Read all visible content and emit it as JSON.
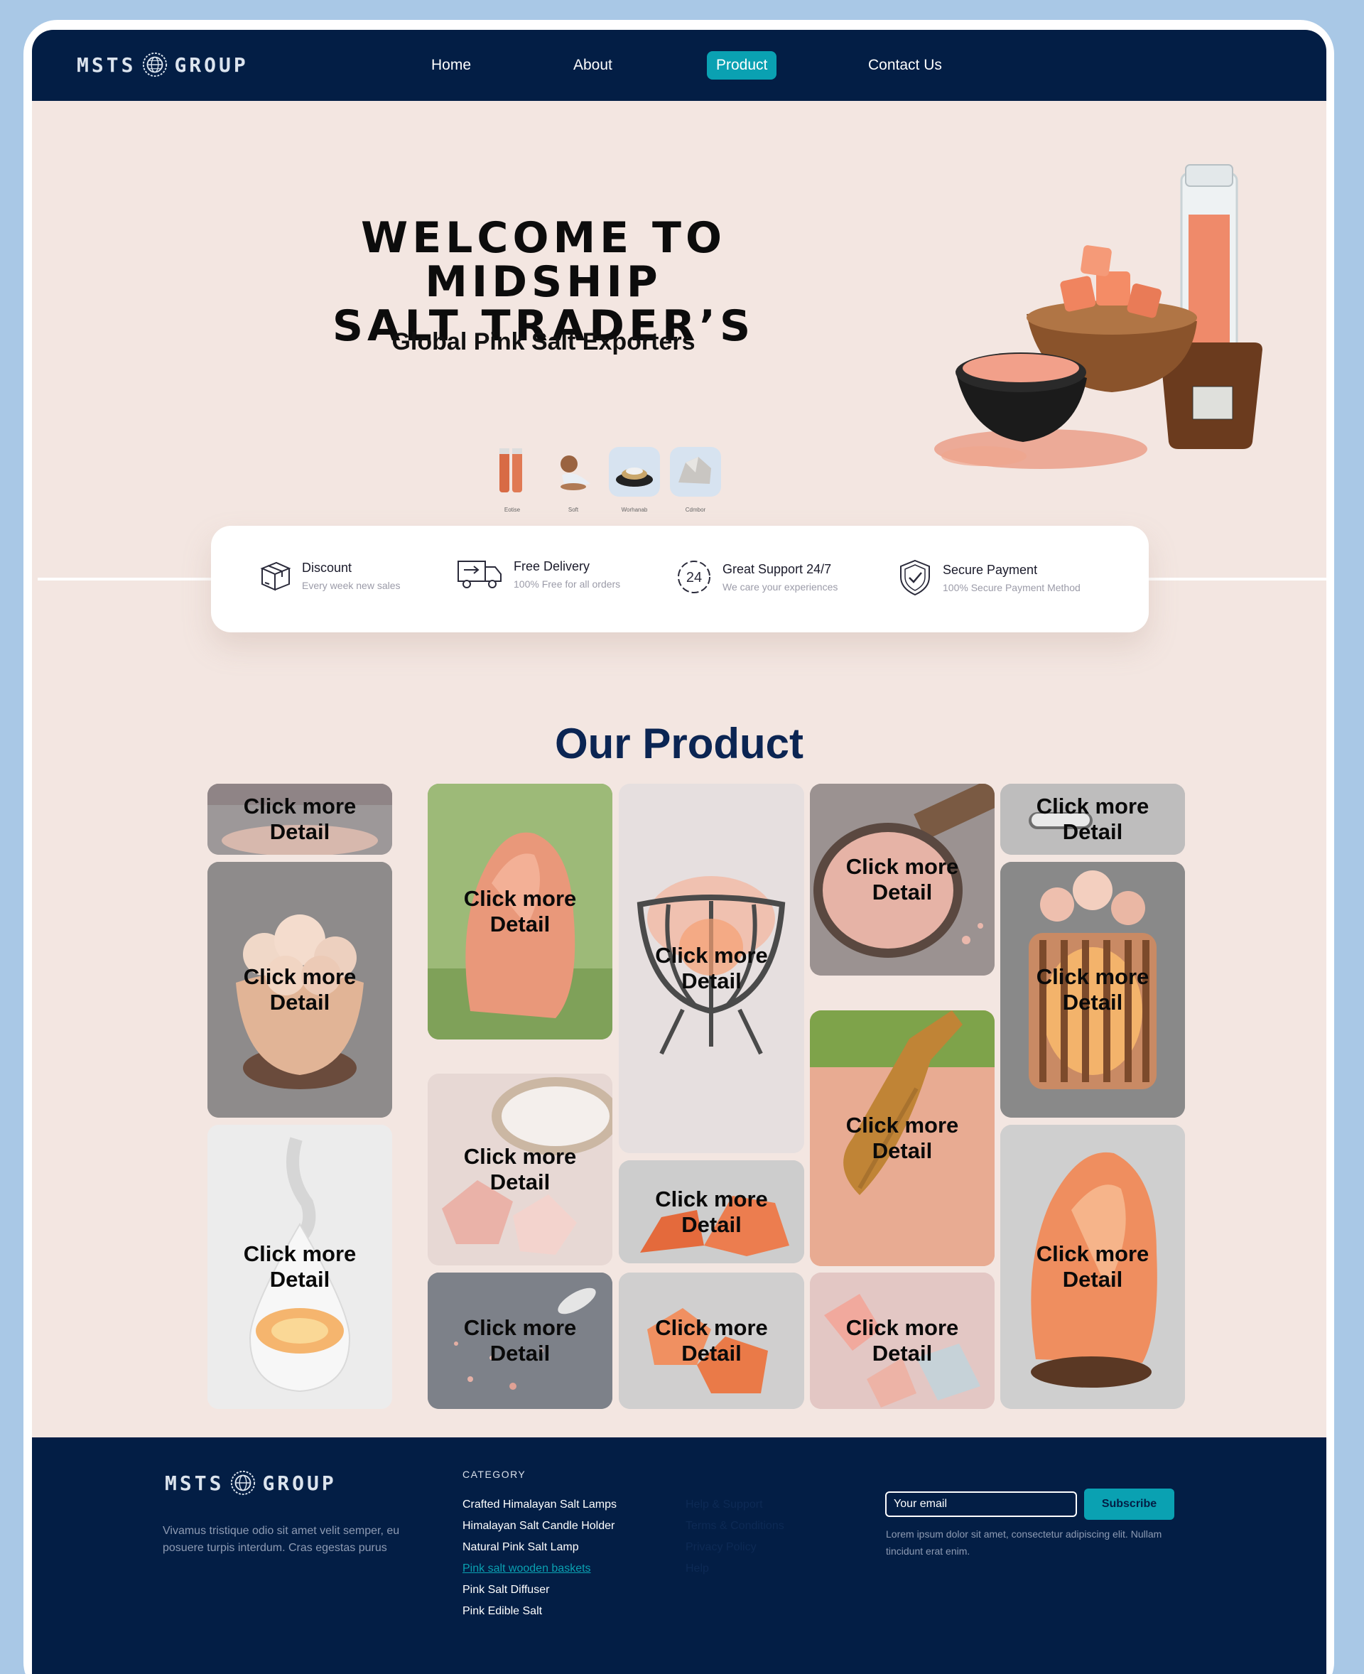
{
  "brand": {
    "name_left": "MSTS",
    "name_right": "GROUP"
  },
  "nav": {
    "items": [
      {
        "label": "Home",
        "active": false
      },
      {
        "label": "About",
        "active": false
      },
      {
        "label": "Product",
        "active": true
      },
      {
        "label": "Contact Us",
        "active": false
      }
    ]
  },
  "hero": {
    "title_line1": "WELCOME TO MIDSHIP",
    "title_line2": "SALT TRADER’S",
    "subtitle": "Global Pink Salt Exporters",
    "thumbs": [
      {
        "caption": "Eotise",
        "icon": "salt-shakers-icon"
      },
      {
        "caption": "Soft",
        "icon": "salt-grinder-icon"
      },
      {
        "caption": "Worhanab",
        "icon": "salt-dish-icon"
      },
      {
        "caption": "Cdmbor",
        "icon": "salt-rock-icon"
      }
    ]
  },
  "features": [
    {
      "title": "Discount",
      "subtitle": "Every week new sales",
      "icon": "box-icon"
    },
    {
      "title": "Free Delivery",
      "subtitle": "100% Free for all orders",
      "icon": "truck-icon"
    },
    {
      "title": "Great Support 24/7",
      "subtitle": "We care your experiences",
      "icon": "support-24-icon"
    },
    {
      "title": "Secure Payment",
      "subtitle": "100% Secure Payment Method",
      "icon": "shield-check-icon"
    }
  ],
  "products": {
    "title": "Our Product",
    "tile_line1": "Click more",
    "tile_line2": "Detail",
    "tiles": [
      "salt-bowl-tile",
      "crystal-bowl-lamp-tile",
      "salt-diffuser-tile",
      "natural-salt-lamp-tile",
      "white-salt-chunks-tile",
      "salt-on-slate-tile",
      "basket-lamp-tile",
      "orange-rock-tile",
      "orange-chunks-tile",
      "salt-in-pan-tile",
      "salt-scoop-tile",
      "salt-crystals-tile",
      "salt-grinder-tile",
      "cage-lamp-tile",
      "rock-lamp-tile"
    ]
  },
  "footer": {
    "description": "Vivamus tristique odio sit amet velit semper, eu posuere turpis interdum. Cras egestas purus",
    "category_heading": "CATEGORY",
    "categories": [
      {
        "label": "Crafted Himalayan Salt Lamps",
        "link": false
      },
      {
        "label": "Himalayan Salt Candle Holder",
        "link": false
      },
      {
        "label": "Natural Pink Salt Lamp",
        "link": false
      },
      {
        "label": "Pink salt wooden baskets",
        "link": true
      },
      {
        "label": "Pink Salt Diffuser",
        "link": false
      },
      {
        "label": "Pink Edible Salt",
        "link": false
      }
    ],
    "help_links": [
      "Help & Support",
      "Terms & Conditions",
      "Privacy Policy",
      "Help"
    ],
    "email_placeholder": "Your email",
    "subscribe_label": "Subscribe",
    "note": "Lorem ipsum dolor sit amet, consectetur adipiscing elit. Nullam tincidunt erat enim."
  },
  "colors": {
    "navy": "#031e45",
    "teal": "#0aa1b2",
    "hero_bg": "#f3e6e1",
    "page_bg": "#a9c8e6"
  }
}
